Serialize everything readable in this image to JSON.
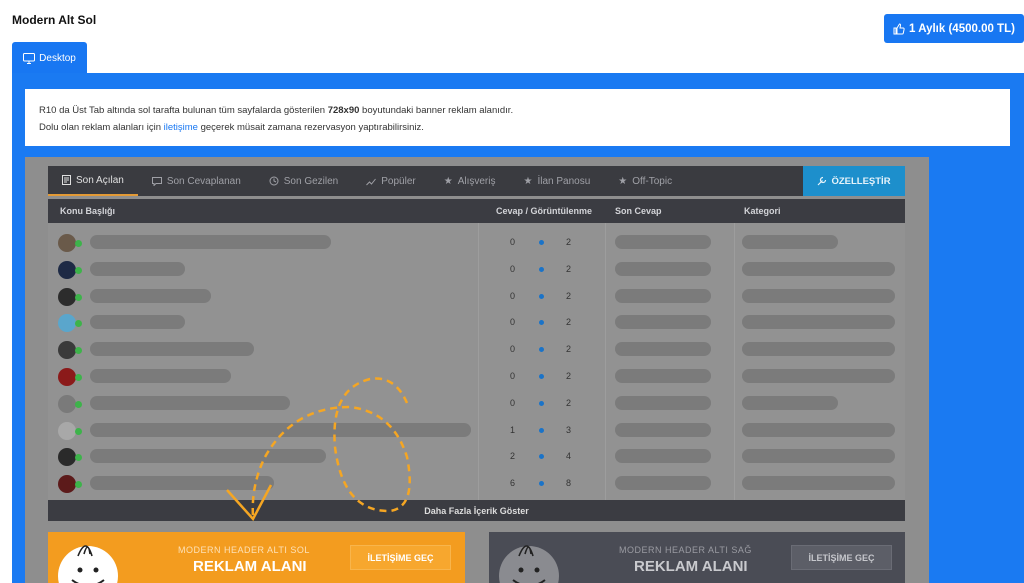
{
  "header": {
    "title": "Modern Alt Sol",
    "price_button": "1 Aylık (4500.00 TL)",
    "tab_label": "Desktop"
  },
  "info": {
    "line1_prefix": "R10 da Üst Tab altında sol tarafta bulunan tüm sayfalarda gösterilen ",
    "line1_bold": "728x90",
    "line1_suffix": " boyutundaki banner reklam alanıdır.",
    "line2_prefix": "Dolu olan reklam alanları için ",
    "line2_link": "iletişime",
    "line2_suffix": " geçerek müsait zamana rezervasyon yaptırabilirsiniz."
  },
  "forum": {
    "tabs": [
      {
        "label": "Son Açılan",
        "icon": "document-icon"
      },
      {
        "label": "Son Cevaplanan",
        "icon": "chat-icon"
      },
      {
        "label": "Son Gezilen",
        "icon": "history-icon"
      },
      {
        "label": "Popüler",
        "icon": "trend-icon"
      },
      {
        "label": "Alışveriş",
        "icon": "star-icon"
      },
      {
        "label": "İlan Panosu",
        "icon": "star-icon"
      },
      {
        "label": "Off-Topic",
        "icon": "star-icon"
      }
    ],
    "customize_label": "ÖZELLEŞTİR",
    "columns": {
      "topic": "Konu Başlığı",
      "stats": "Cevap / Görüntülenme",
      "last_reply": "Son Cevap",
      "category": "Kategori"
    },
    "rows": [
      {
        "replies": "0",
        "views": "2"
      },
      {
        "replies": "0",
        "views": "2"
      },
      {
        "replies": "0",
        "views": "2"
      },
      {
        "replies": "0",
        "views": "2"
      },
      {
        "replies": "0",
        "views": "2"
      },
      {
        "replies": "0",
        "views": "2"
      },
      {
        "replies": "0",
        "views": "2"
      },
      {
        "replies": "1",
        "views": "3"
      },
      {
        "replies": "2",
        "views": "4"
      },
      {
        "replies": "6",
        "views": "8"
      }
    ],
    "more_label": "Daha Fazla İçerik Göster"
  },
  "ads": {
    "left": {
      "subtitle": "MODERN HEADER ALTI SOL",
      "title": "REKLAM ALANI",
      "button": "İLETİŞİME GEÇ"
    },
    "right": {
      "subtitle": "MODERN HEADER ALTI SAĞ",
      "title": "REKLAM ALANI",
      "button": "İLETİŞİME GEÇ"
    }
  },
  "colors": {
    "accent_blue": "#1877f2",
    "highlight_orange": "#f39c1f",
    "online_green": "#3db34a"
  }
}
